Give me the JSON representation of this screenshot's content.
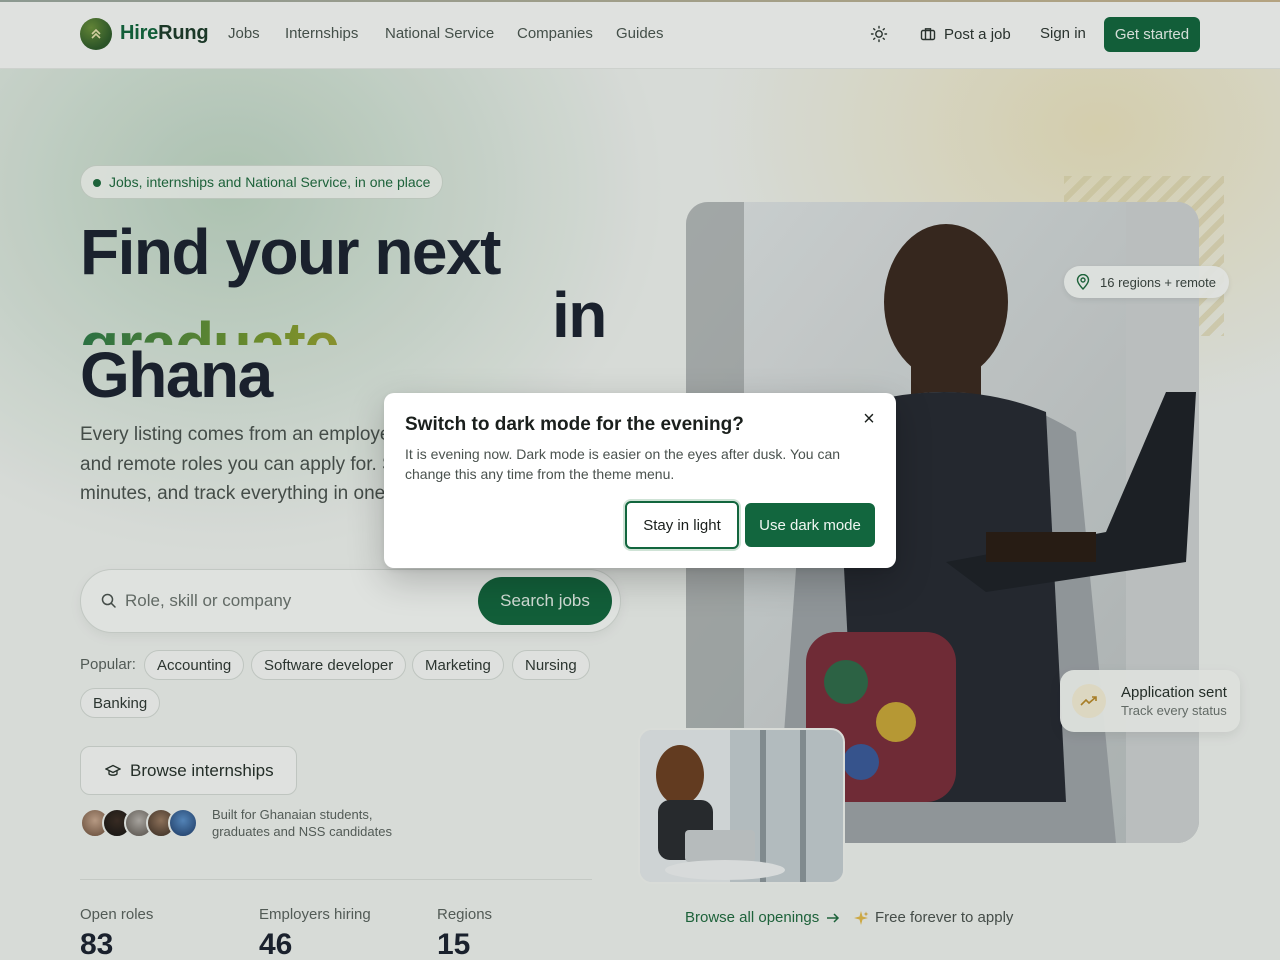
{
  "nav": {
    "brand": {
      "hire": "Hire",
      "rung": "Rung"
    },
    "links": [
      "Jobs",
      "Internships",
      "National Service",
      "Companies",
      "Guides"
    ],
    "theme_icon": "sun-icon",
    "post_job": "Post a job",
    "sign_in": "Sign in",
    "get_started": "Get started"
  },
  "hero": {
    "badge": "Jobs, internships and National Service, in one place",
    "headline_line1": "Find your next",
    "headline_rotating": "graduate role",
    "headline_in": "in",
    "headline_ghana": "Ghana",
    "lead": "Every listing comes from an employer across all sixteen regions and remote roles you can apply for. Search free, apply in minutes, and track everything in one place.",
    "search": {
      "placeholder": "Role, skill or company",
      "button": "Search jobs"
    },
    "popular_label": "Popular:",
    "popular": [
      "Accounting",
      "Software developer",
      "Marketing",
      "Nursing",
      "Banking"
    ],
    "browse_internships": "Browse internships",
    "built_for": "Built for Ghanaian students, graduates and NSS candidates",
    "stats": [
      {
        "label": "Open roles",
        "value": "83"
      },
      {
        "label": "Employers hiring",
        "value": "46"
      },
      {
        "label": "Regions",
        "value": "15"
      }
    ],
    "regions_badge": "16 regions + remote",
    "application_card": {
      "title": "Application sent",
      "subtitle": "Track every status"
    },
    "browse_all": "Browse all openings",
    "free": "Free forever to apply"
  },
  "modal": {
    "title": "Switch to dark mode for the evening?",
    "body": "It is evening now. Dark mode is easier on the eyes after dusk. You can change this any time from the theme menu.",
    "stay_light": "Stay in light",
    "use_dark": "Use dark mode",
    "close": "×"
  },
  "colors": {
    "brand_green": "#12663e",
    "accent_gold": "#c9a638"
  }
}
